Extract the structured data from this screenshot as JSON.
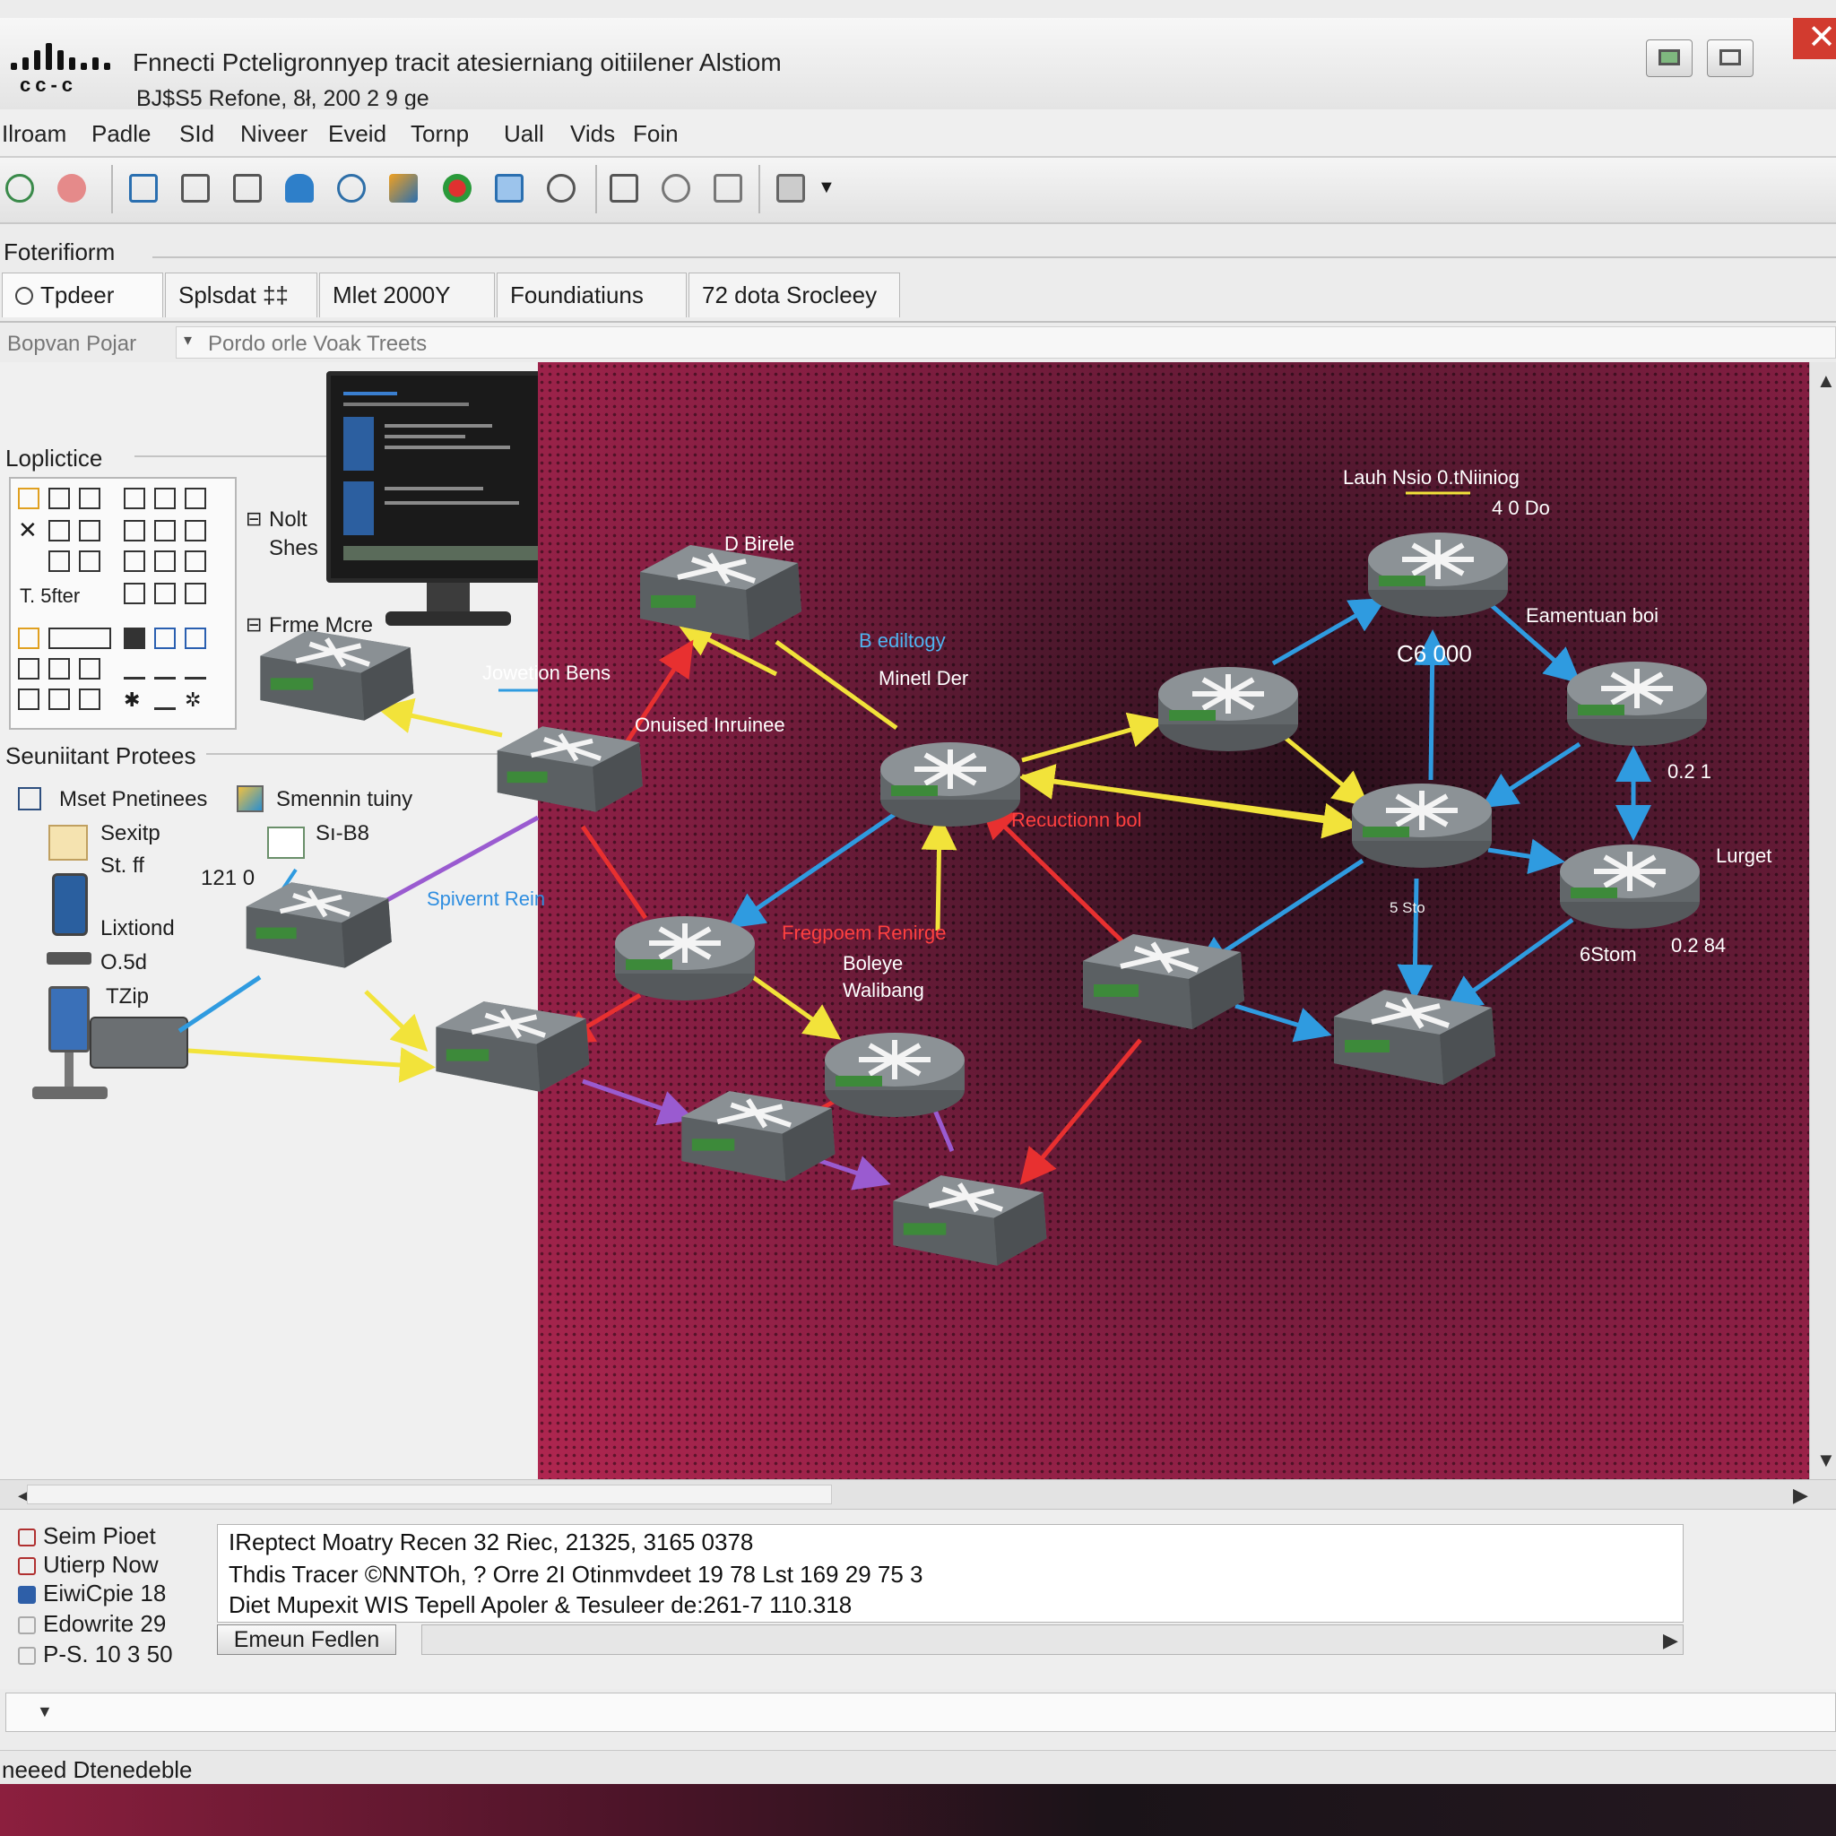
{
  "window": {
    "title": "Fnnecti Pcteligronnyep tracit atesierniang oitiilener Alstiom",
    "subtitle": "BJ$S5 Refone, 8ł, 200 2 9 ge"
  },
  "brand": {
    "logo_text": "cc-c"
  },
  "menu": [
    "Ilroam",
    "Padle",
    "SId",
    "Niveer",
    "Eveid",
    "Tornp",
    "Uall",
    "Vids",
    "Foin"
  ],
  "toolbar_icons": [
    "network-icon",
    "globe-icon",
    "clipboard-icon",
    "document-icon",
    "document-edit-icon",
    "cloud-icon",
    "router-icon",
    "image-icon",
    "record-icon",
    "monitor-icon",
    "search-icon",
    "save-icon",
    "refresh-icon",
    "notes-icon",
    "display-icon"
  ],
  "panel": {
    "label": "Foterifiorm"
  },
  "tabs": [
    {
      "label": "Tpdeer",
      "active": true
    },
    {
      "label": "Splsdat  ‡‡"
    },
    {
      "label": "Mlet 2000Y"
    },
    {
      "label": "Foundiatiuns"
    },
    {
      "label": "72 dota Srocleey"
    }
  ],
  "pathbar": {
    "left": "Bopvan Pojar",
    "right": "Pordo orle Voak Treets"
  },
  "left": {
    "section1": "Loplictice",
    "palette_caption": "T. 5fter",
    "side_items": [
      "Nolt",
      "Shes",
      "Frme Mcre"
    ],
    "jovelon_label": "Jowetion Bens",
    "section2": "Seuniitant Protees",
    "items": [
      "Mset Pnetinees",
      "Smennin tuiny",
      "Sexitp",
      "Sı-B8",
      "St. ff",
      "121 0",
      "Lixtiond",
      "O.5d",
      "TZip"
    ]
  },
  "canvas": {
    "annotations": {
      "top_right": "Lauh Nsio 0.tNiiniog",
      "top_right_sub": "4 0 Do",
      "b_edihloy": "B ediltogy",
      "minetl": "Minetl Der",
      "dbirie": "D Birele",
      "eamenuan": "Eamentuan boi",
      "c600": "C6 000",
      "onuise": "Onuised Inruinee",
      "spiveint": "Spivernt Rein",
      "recuction": "Recuctionn bol",
      "fregpoem": "Fregpoem Renirge",
      "boleye": "Boleye",
      "walibang": "Walibang",
      "larget": "Lurget",
      "gstom": "6Stom",
      "n0211": "0.2 1",
      "n0284": "0.2 84",
      "sto": "5 Sto"
    }
  },
  "console": {
    "side_items": [
      {
        "label": "Seim Pioet",
        "color": "#b03030"
      },
      {
        "label": "Utierp Now",
        "color": "#b03030"
      },
      {
        "label": "EiwiCpie 18",
        "color": "#2e5fa8"
      },
      {
        "label": "Edowrite 29",
        "color": "#999999"
      },
      {
        "label": "P-S. 10 3 50",
        "color": "#999999"
      }
    ],
    "lines": [
      "IReptect Moatry Recen 32 Riec, 21325, 3165 0378",
      "Thdis Tracer ©NNTOh, ? Orre 2I Otinmvdeet 19 78 Lst 169 29 75 3",
      "Diet Mupexit WIS Tepell Apoler & Tesuleer de:261-7 110.318"
    ],
    "button": "Emeun Fedlen"
  },
  "status": {
    "text": "neeed Dtenedeble"
  }
}
